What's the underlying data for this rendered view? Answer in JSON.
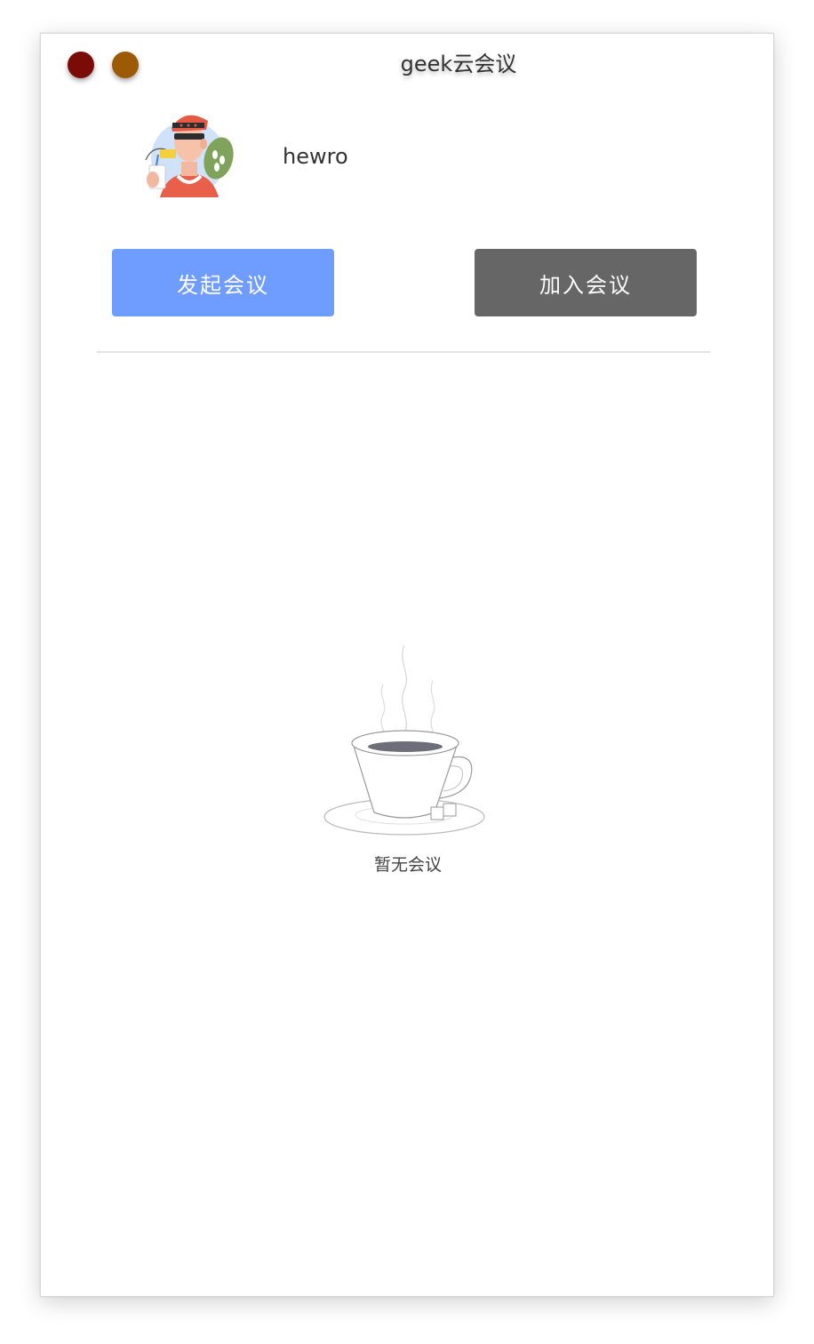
{
  "window": {
    "title": "geek云会议",
    "controls": {
      "close_color": "#7a0b06",
      "minimize_color": "#9c5a04"
    }
  },
  "profile": {
    "username": "hewro",
    "avatar_icon": "user-avatar-illustration"
  },
  "actions": {
    "start_label": "发起会议",
    "start_color": "#6f9cff",
    "join_label": "加入会议",
    "join_color": "#666666"
  },
  "meetings": {
    "empty_icon": "coffee-cup-icon",
    "empty_text": "暂无会议"
  }
}
